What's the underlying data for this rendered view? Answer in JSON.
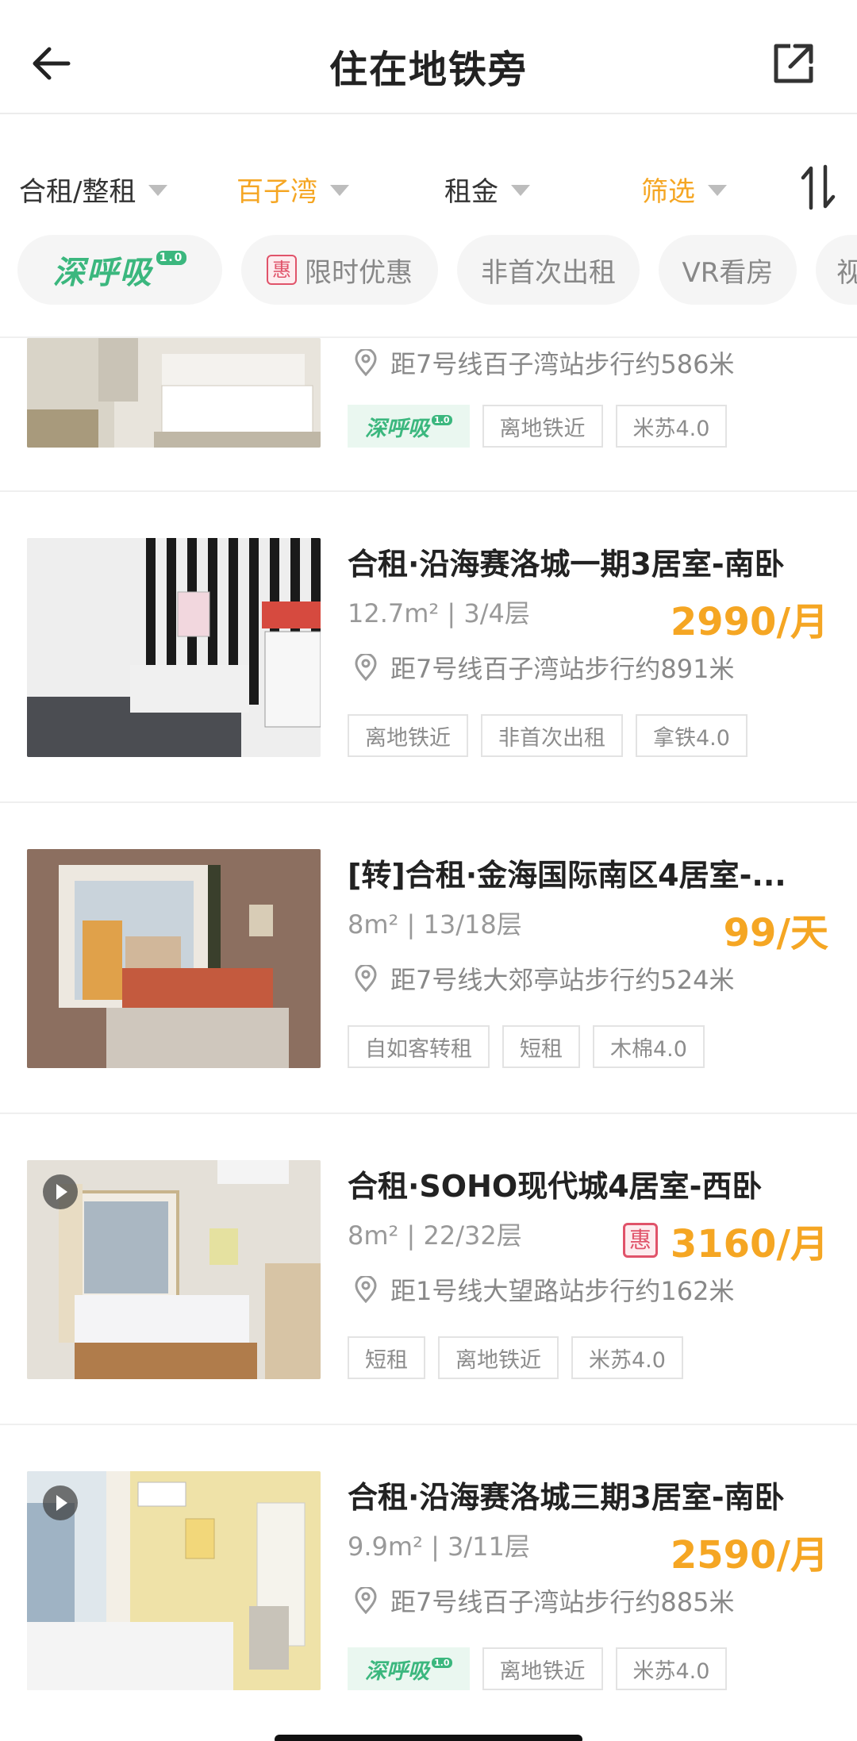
{
  "header": {
    "title": "住在地铁旁",
    "back_icon": "arrow-left-icon",
    "share_icon": "external-link-icon"
  },
  "filters": [
    {
      "label": "合租/整租",
      "color": "#333333"
    },
    {
      "label": "百子湾",
      "color": "#f5a623"
    },
    {
      "label": "租金",
      "color": "#333333"
    },
    {
      "label": "筛选",
      "color": "#f5a623"
    }
  ],
  "pills": {
    "shenhuxi": "深呼吸",
    "shenhuxi_version": "1.0",
    "hui_badge": "惠",
    "limited_offer": "限时优惠",
    "non_first": "非首次出租",
    "vr": "VR看房",
    "partial": "视"
  },
  "listings": [
    {
      "title": "",
      "meta": "",
      "price": "",
      "location": "距7号线百子湾站步行约586米",
      "tags": [
        "深呼吸",
        "离地铁近",
        "米苏4.0"
      ],
      "green_tag_version": "1.0"
    },
    {
      "title": "合租·沿海赛洛城一期3居室-南卧",
      "meta": "12.7m² | 3/4层",
      "price": "2990/月",
      "location": "距7号线百子湾站步行约891米",
      "tags": [
        "离地铁近",
        "非首次出租",
        "拿铁4.0"
      ]
    },
    {
      "title": "[转]合租·金海国际南区4居室-...",
      "meta": "8m² | 13/18层",
      "price": "99/天",
      "location": "距7号线大郊亭站步行约524米",
      "tags": [
        "自如客转租",
        "短租",
        "木棉4.0"
      ]
    },
    {
      "title": "合租·SOHO现代城4居室-西卧",
      "meta": "8m² | 22/32层",
      "price": "3160/月",
      "price_badge": "惠",
      "location": "距1号线大望路站步行约162米",
      "tags": [
        "短租",
        "离地铁近",
        "米苏4.0"
      ]
    },
    {
      "title": "合租·沿海赛洛城三期3居室-南卧",
      "meta": "9.9m² | 3/11层",
      "price": "2590/月",
      "location": "距7号线百子湾站步行约885米",
      "tags": [
        "深呼吸",
        "离地铁近",
        "米苏4.0"
      ],
      "green_tag_version": "1.0"
    }
  ],
  "colors": {
    "accent": "#f5a623",
    "green": "#3bb77e",
    "hui_red": "#e0536a"
  }
}
